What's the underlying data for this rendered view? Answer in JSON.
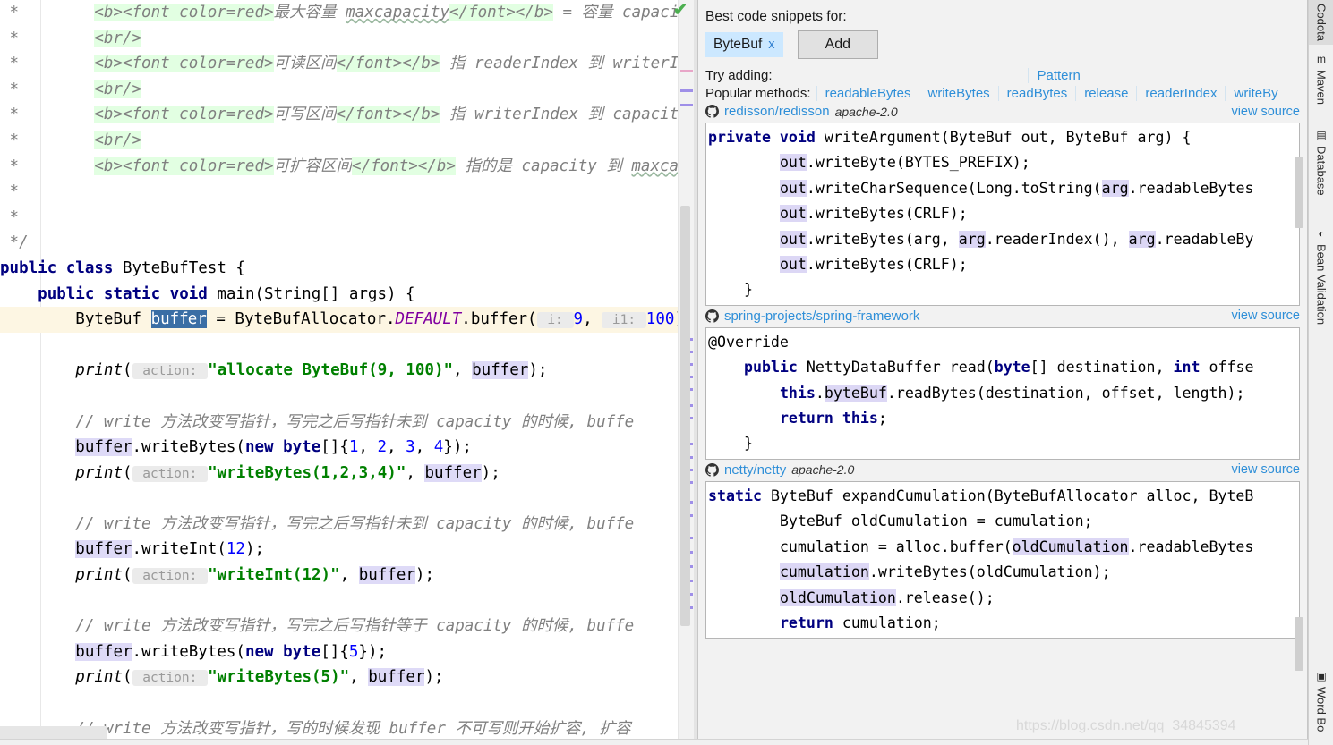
{
  "editor": {
    "lines": [
      {
        "id": "l1",
        "parts": [
          {
            "t": " *        ",
            "c": "jdoc"
          },
          {
            "t": "<b><font color=red>",
            "c": "jtag"
          },
          {
            "t": "最大容量 ",
            "c": "jdoc"
          },
          {
            "t": "maxcapacity",
            "c": "jdoc wavy"
          },
          {
            "t": "</font></b>",
            "c": "jtag"
          },
          {
            "t": " = 容量 capacit",
            "c": "jdoc"
          }
        ]
      },
      {
        "id": "l2",
        "parts": [
          {
            "t": " *        ",
            "c": "jdoc"
          },
          {
            "t": "<br/>",
            "c": "jtag"
          }
        ]
      },
      {
        "id": "l3",
        "parts": [
          {
            "t": " *        ",
            "c": "jdoc"
          },
          {
            "t": "<b><font color=red>",
            "c": "jtag"
          },
          {
            "t": "可读区间",
            "c": "jdoc"
          },
          {
            "t": "</font></b>",
            "c": "jtag"
          },
          {
            "t": " 指 readerIndex 到 writerIn",
            "c": "jdoc"
          }
        ]
      },
      {
        "id": "l4",
        "parts": [
          {
            "t": " *        ",
            "c": "jdoc"
          },
          {
            "t": "<br/>",
            "c": "jtag"
          }
        ]
      },
      {
        "id": "l5",
        "parts": [
          {
            "t": " *        ",
            "c": "jdoc"
          },
          {
            "t": "<b><font color=red>",
            "c": "jtag"
          },
          {
            "t": "可写区间",
            "c": "jdoc"
          },
          {
            "t": "</font></b>",
            "c": "jtag"
          },
          {
            "t": " 指 writerIndex 到 capacity",
            "c": "jdoc"
          }
        ]
      },
      {
        "id": "l6",
        "parts": [
          {
            "t": " *        ",
            "c": "jdoc"
          },
          {
            "t": "<br/>",
            "c": "jtag"
          }
        ]
      },
      {
        "id": "l7",
        "parts": [
          {
            "t": " *        ",
            "c": "jdoc"
          },
          {
            "t": "<b><font color=red>",
            "c": "jtag"
          },
          {
            "t": "可扩容区间",
            "c": "jdoc"
          },
          {
            "t": "</font></b>",
            "c": "jtag"
          },
          {
            "t": " 指的是 capacity 到 ",
            "c": "jdoc"
          },
          {
            "t": "maxca",
            "c": "jdoc wavy"
          }
        ]
      },
      {
        "id": "l8",
        "parts": [
          {
            "t": " *",
            "c": "jdoc"
          }
        ]
      },
      {
        "id": "l9",
        "parts": [
          {
            "t": " *",
            "c": "jdoc"
          }
        ]
      },
      {
        "id": "l10",
        "parts": [
          {
            "t": " */",
            "c": "jdoc"
          }
        ]
      },
      {
        "id": "l11",
        "parts": [
          {
            "t": "public class ",
            "c": "kw"
          },
          {
            "t": "ByteBufTest {",
            "c": "plain"
          }
        ]
      },
      {
        "id": "l12",
        "parts": [
          {
            "t": "    ",
            "c": "plain"
          },
          {
            "t": "public static void ",
            "c": "kw"
          },
          {
            "t": "main(String[] args) {",
            "c": "plain"
          }
        ]
      },
      {
        "id": "l13",
        "highlight": true,
        "parts": [
          {
            "t": "        ByteBuf ",
            "c": "plain"
          },
          {
            "t": "buff",
            "c": "sel"
          },
          {
            "t": "CARET",
            "c": "caret"
          },
          {
            "t": "er",
            "c": "sel"
          },
          {
            "t": " = ByteBufAllocator.",
            "c": "plain"
          },
          {
            "t": "DEFAULT",
            "c": "stat"
          },
          {
            "t": ".buffer(",
            "c": "plain"
          },
          {
            "t": " i: ",
            "c": "phint"
          },
          {
            "t": "9",
            "c": "num"
          },
          {
            "t": ", ",
            "c": "plain"
          },
          {
            "t": " i1: ",
            "c": "phint"
          },
          {
            "t": "100",
            "c": "num"
          },
          {
            "t": ");",
            "c": "plain"
          }
        ]
      },
      {
        "id": "l14",
        "parts": []
      },
      {
        "id": "l15",
        "parts": [
          {
            "t": "        ",
            "c": "plain"
          },
          {
            "t": "print",
            "c": "mth"
          },
          {
            "t": "(",
            "c": "plain"
          },
          {
            "t": " action: ",
            "c": "phint"
          },
          {
            "t": "\"allocate ByteBuf(9, 100)\"",
            "c": "str"
          },
          {
            "t": ", ",
            "c": "plain"
          },
          {
            "t": "buffer",
            "c": "ident-hl"
          },
          {
            "t": ");",
            "c": "plain"
          }
        ]
      },
      {
        "id": "l16",
        "parts": []
      },
      {
        "id": "l17",
        "parts": [
          {
            "t": "        // write 方法改变写指针，写完之后写指针未到 capacity 的时候, buffe",
            "c": "cmt"
          }
        ]
      },
      {
        "id": "l18",
        "parts": [
          {
            "t": "        ",
            "c": "plain"
          },
          {
            "t": "buffer",
            "c": "ident-hl"
          },
          {
            "t": ".writeBytes(",
            "c": "plain"
          },
          {
            "t": "new byte",
            "c": "kw"
          },
          {
            "t": "[]{",
            "c": "plain"
          },
          {
            "t": "1",
            "c": "num"
          },
          {
            "t": ", ",
            "c": "plain"
          },
          {
            "t": "2",
            "c": "num"
          },
          {
            "t": ", ",
            "c": "plain"
          },
          {
            "t": "3",
            "c": "num"
          },
          {
            "t": ", ",
            "c": "plain"
          },
          {
            "t": "4",
            "c": "num"
          },
          {
            "t": "});",
            "c": "plain"
          }
        ]
      },
      {
        "id": "l19",
        "parts": [
          {
            "t": "        ",
            "c": "plain"
          },
          {
            "t": "print",
            "c": "mth"
          },
          {
            "t": "(",
            "c": "plain"
          },
          {
            "t": " action: ",
            "c": "phint"
          },
          {
            "t": "\"writeBytes(1,2,3,4)\"",
            "c": "str"
          },
          {
            "t": ", ",
            "c": "plain"
          },
          {
            "t": "buffer",
            "c": "ident-hl"
          },
          {
            "t": ");",
            "c": "plain"
          }
        ]
      },
      {
        "id": "l20",
        "parts": []
      },
      {
        "id": "l21",
        "parts": [
          {
            "t": "        // write 方法改变写指针，写完之后写指针未到 capacity 的时候, buffe",
            "c": "cmt"
          }
        ]
      },
      {
        "id": "l22",
        "parts": [
          {
            "t": "        ",
            "c": "plain"
          },
          {
            "t": "buffer",
            "c": "ident-hl"
          },
          {
            "t": ".writeInt(",
            "c": "plain"
          },
          {
            "t": "12",
            "c": "num"
          },
          {
            "t": ");",
            "c": "plain"
          }
        ]
      },
      {
        "id": "l23",
        "parts": [
          {
            "t": "        ",
            "c": "plain"
          },
          {
            "t": "print",
            "c": "mth"
          },
          {
            "t": "(",
            "c": "plain"
          },
          {
            "t": " action: ",
            "c": "phint"
          },
          {
            "t": "\"writeInt(12)\"",
            "c": "str"
          },
          {
            "t": ", ",
            "c": "plain"
          },
          {
            "t": "buffer",
            "c": "ident-hl"
          },
          {
            "t": ");",
            "c": "plain"
          }
        ]
      },
      {
        "id": "l24",
        "parts": []
      },
      {
        "id": "l25",
        "parts": [
          {
            "t": "        // write 方法改变写指针，写完之后写指针等于 capacity 的时候, buffe",
            "c": "cmt"
          }
        ]
      },
      {
        "id": "l26",
        "parts": [
          {
            "t": "        ",
            "c": "plain"
          },
          {
            "t": "buffer",
            "c": "ident-hl"
          },
          {
            "t": ".writeBytes(",
            "c": "plain"
          },
          {
            "t": "new byte",
            "c": "kw"
          },
          {
            "t": "[]{",
            "c": "plain"
          },
          {
            "t": "5",
            "c": "num"
          },
          {
            "t": "});",
            "c": "plain"
          }
        ]
      },
      {
        "id": "l27",
        "parts": [
          {
            "t": "        ",
            "c": "plain"
          },
          {
            "t": "print",
            "c": "mth"
          },
          {
            "t": "(",
            "c": "plain"
          },
          {
            "t": " action: ",
            "c": "phint"
          },
          {
            "t": "\"writeBytes(5)\"",
            "c": "str"
          },
          {
            "t": ", ",
            "c": "plain"
          },
          {
            "t": "buffer",
            "c": "ident-hl"
          },
          {
            "t": ");",
            "c": "plain"
          }
        ]
      },
      {
        "id": "l28",
        "parts": []
      },
      {
        "id": "l29",
        "parts": [
          {
            "t": "        // write 方法改变写指针，写的时候发现 buffer 不可写则开始扩容, 扩容",
            "c": "cmt"
          }
        ]
      }
    ],
    "inspection_status": "✔"
  },
  "panel": {
    "title": "Best code snippets for:",
    "tag": {
      "label": "ByteBuf",
      "close": "x"
    },
    "add_label": "Add",
    "try_adding_label": "Try adding:",
    "try_adding_items": [
      "Pattern"
    ],
    "popular_methods_label": "Popular methods:",
    "popular_methods": [
      "readableBytes",
      "writeBytes",
      "readBytes",
      "release",
      "readerIndex",
      "writeBy"
    ],
    "view_source_label": "view source",
    "snippets": [
      {
        "repo": "redisson/redisson",
        "license": "apache-2.0",
        "lines": [
          [
            {
              "t": "private void ",
              "c": "kw"
            },
            {
              "t": "writeArgument(ByteBuf out, ByteBuf arg) {",
              "c": "plain"
            }
          ],
          [
            {
              "t": "        ",
              "c": "plain"
            },
            {
              "t": "out",
              "c": "ident-hl"
            },
            {
              "t": ".writeByte(BYTES_PREFIX);",
              "c": "plain"
            }
          ],
          [
            {
              "t": "        ",
              "c": "plain"
            },
            {
              "t": "out",
              "c": "ident-hl"
            },
            {
              "t": ".writeCharSequence(Long.toString(",
              "c": "plain"
            },
            {
              "t": "arg",
              "c": "ident-hl"
            },
            {
              "t": ".readableBytes",
              "c": "plain"
            }
          ],
          [
            {
              "t": "        ",
              "c": "plain"
            },
            {
              "t": "out",
              "c": "ident-hl"
            },
            {
              "t": ".writeBytes(CRLF);",
              "c": "plain"
            }
          ],
          [
            {
              "t": "        ",
              "c": "plain"
            },
            {
              "t": "out",
              "c": "ident-hl"
            },
            {
              "t": ".writeBytes(arg, ",
              "c": "plain"
            },
            {
              "t": "arg",
              "c": "ident-hl"
            },
            {
              "t": ".readerIndex(), ",
              "c": "plain"
            },
            {
              "t": "arg",
              "c": "ident-hl"
            },
            {
              "t": ".readableBy",
              "c": "plain"
            }
          ],
          [
            {
              "t": "        ",
              "c": "plain"
            },
            {
              "t": "out",
              "c": "ident-hl"
            },
            {
              "t": ".writeBytes(CRLF);",
              "c": "plain"
            }
          ],
          [
            {
              "t": "    }",
              "c": "plain"
            }
          ],
          [
            {
              "t": "",
              "c": "plain"
            }
          ]
        ]
      },
      {
        "repo": "spring-projects/spring-framework",
        "license": "",
        "lines": [
          [
            {
              "t": "@Override",
              "c": "plain"
            }
          ],
          [
            {
              "t": "    ",
              "c": "plain"
            },
            {
              "t": "public ",
              "c": "kw"
            },
            {
              "t": "NettyDataBuffer read(",
              "c": "plain"
            },
            {
              "t": "byte",
              "c": "kw"
            },
            {
              "t": "[] destination, ",
              "c": "plain"
            },
            {
              "t": "int ",
              "c": "kw"
            },
            {
              "t": "offse",
              "c": "plain"
            }
          ],
          [
            {
              "t": "        ",
              "c": "plain"
            },
            {
              "t": "this",
              "c": "kw"
            },
            {
              "t": ".",
              "c": "plain"
            },
            {
              "t": "byteBuf",
              "c": "ident-hl"
            },
            {
              "t": ".readBytes(destination, offset, length);",
              "c": "plain"
            }
          ],
          [
            {
              "t": "        ",
              "c": "plain"
            },
            {
              "t": "return this",
              "c": "kw"
            },
            {
              "t": ";",
              "c": "plain"
            }
          ],
          [
            {
              "t": "    }",
              "c": "plain"
            }
          ],
          [
            {
              "t": "",
              "c": "plain"
            }
          ]
        ]
      },
      {
        "repo": "netty/netty",
        "license": "apache-2.0",
        "lines": [
          [
            {
              "t": "static ",
              "c": "kw"
            },
            {
              "t": "ByteBuf expandCumulation(ByteBufAllocator alloc, ByteB",
              "c": "plain"
            }
          ],
          [
            {
              "t": "        ByteBuf oldCumulation = cumulation;",
              "c": "plain"
            }
          ],
          [
            {
              "t": "        cumulation = alloc.buffer(",
              "c": "plain"
            },
            {
              "t": "oldCumulation",
              "c": "ident-hl"
            },
            {
              "t": ".readableBytes",
              "c": "plain"
            }
          ],
          [
            {
              "t": "        ",
              "c": "plain"
            },
            {
              "t": "cumulation",
              "c": "ident-hl"
            },
            {
              "t": ".writeBytes(oldCumulation);",
              "c": "plain"
            }
          ],
          [
            {
              "t": "        ",
              "c": "plain"
            },
            {
              "t": "oldCumulation",
              "c": "ident-hl"
            },
            {
              "t": ".release();",
              "c": "plain"
            }
          ],
          [
            {
              "t": "        ",
              "c": "plain"
            },
            {
              "t": "return ",
              "c": "kw"
            },
            {
              "t": "cumulation;",
              "c": "plain"
            }
          ]
        ]
      }
    ]
  },
  "toolbar_right": {
    "items": [
      {
        "label": "Codota",
        "icon": "",
        "active": true
      },
      {
        "label": "Maven",
        "icon": "m"
      },
      {
        "label": "Database",
        "icon": "▤"
      },
      {
        "label": "Bean Validation",
        "icon": "◐"
      },
      {
        "label": "Word Bo",
        "icon": "▣"
      }
    ]
  },
  "watermark": "https://blog.csdn.net/qq_34845394",
  "colors": {
    "accent_link": "#2f8fd8",
    "tag_chip_bg": "#cce8ff",
    "keyword": "#000080",
    "string": "#008000",
    "number": "#0000ff",
    "comment": "#808080",
    "identifier_highlight": "#dcd7f5",
    "selection": "#3a6ea5",
    "panel_bg": "#f2f2f2"
  }
}
